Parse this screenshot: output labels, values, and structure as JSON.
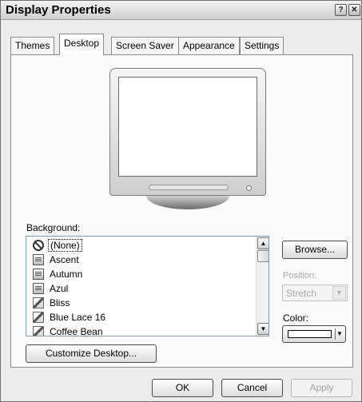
{
  "window": {
    "title": "Display Properties",
    "help_glyph": "?",
    "close_glyph": "✕"
  },
  "tabs": [
    {
      "label": "Themes"
    },
    {
      "label": "Desktop"
    },
    {
      "label": "Screen Saver"
    },
    {
      "label": "Appearance"
    },
    {
      "label": "Settings"
    }
  ],
  "active_tab": "Desktop",
  "background": {
    "label": "Background:",
    "items": [
      {
        "label": "(None)",
        "icon": "none-icon",
        "selected": true
      },
      {
        "label": "Ascent",
        "icon": "image-file-icon"
      },
      {
        "label": "Autumn",
        "icon": "image-file-icon"
      },
      {
        "label": "Azul",
        "icon": "image-file-icon"
      },
      {
        "label": "Bliss",
        "icon": "bitmap-brush-icon"
      },
      {
        "label": "Blue Lace 16",
        "icon": "bitmap-brush-icon"
      },
      {
        "label": "Coffee Bean",
        "icon": "bitmap-brush-icon"
      }
    ],
    "scroll_up": "▲",
    "scroll_down": "▼"
  },
  "browse_label": "Browse...",
  "position": {
    "label": "Position:",
    "value": "Stretch",
    "arrow": "▼"
  },
  "color": {
    "label": "Color:",
    "value": "#ffffff",
    "arrow": "▼"
  },
  "customize_label": "Customize Desktop...",
  "footer": {
    "ok_label": "OK",
    "cancel_label": "Cancel",
    "apply_label": "Apply"
  }
}
